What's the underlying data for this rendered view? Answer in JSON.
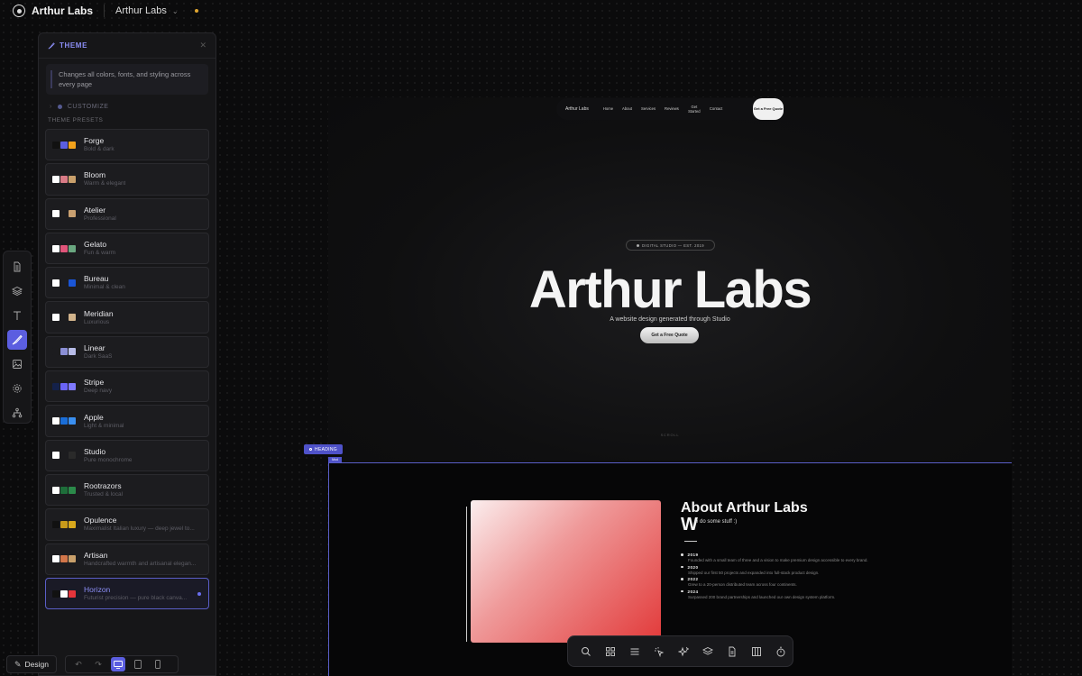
{
  "topbar": {
    "app_name": "Arthur Labs",
    "project_name": "Arthur Labs"
  },
  "panel": {
    "title": "THEME",
    "description": "Changes all colors, fonts, and styling across every page",
    "customize_label": "CUSTOMIZE",
    "presets_label": "THEME PRESETS",
    "presets": [
      {
        "name": "Forge",
        "desc": "Bold & dark",
        "colors": [
          "#111111",
          "#5b5ee0",
          "#f2a21b"
        ]
      },
      {
        "name": "Bloom",
        "desc": "Warm & elegant",
        "colors": [
          "#ffffff",
          "#d97b86",
          "#c9a06b"
        ]
      },
      {
        "name": "Atelier",
        "desc": "Professional",
        "colors": [
          "#ffffff",
          "#1c1c1f",
          "#c9a070"
        ]
      },
      {
        "name": "Gelato",
        "desc": "Fun & warm",
        "colors": [
          "#ffffff",
          "#e0557a",
          "#6aa780"
        ]
      },
      {
        "name": "Bureau",
        "desc": "Minimal & clean",
        "colors": [
          "#ffffff",
          "#1c1c1f",
          "#1a55d6"
        ]
      },
      {
        "name": "Meridian",
        "desc": "Luxurious",
        "colors": [
          "#ffffff",
          "#1c1c1f",
          "#d2b48c"
        ]
      },
      {
        "name": "Linear",
        "desc": "Dark SaaS",
        "colors": [
          "#1c1c1f",
          "#8b8fd6",
          "#b8bce8"
        ]
      },
      {
        "name": "Stripe",
        "desc": "Deep navy",
        "colors": [
          "#14214a",
          "#6a63f5",
          "#7f79ff"
        ]
      },
      {
        "name": "Apple",
        "desc": "Light & minimal",
        "colors": [
          "#ffffff",
          "#1a6ed8",
          "#3a8ff0"
        ]
      },
      {
        "name": "Studio",
        "desc": "Pure monochrome",
        "colors": [
          "#ffffff",
          "#1c1c1f",
          "#2a2a2a"
        ]
      },
      {
        "name": "Rootrazors",
        "desc": "Trusted & local",
        "colors": [
          "#ffffff",
          "#1e6e3a",
          "#2b8a4a"
        ]
      },
      {
        "name": "Opulence",
        "desc": "Maximalist Italian luxury — deep jewel to...",
        "colors": [
          "#111111",
          "#c89a1a",
          "#d8a81c"
        ]
      },
      {
        "name": "Artisan",
        "desc": "Handcrafted warmth and artisanal elegan...",
        "colors": [
          "#ffffff",
          "#d2764a",
          "#c9a06b"
        ]
      },
      {
        "name": "Horizon",
        "desc": "Futurist precision — pure black canva...",
        "colors": [
          "#111111",
          "#ffffff",
          "#e5353b"
        ],
        "active": true
      }
    ]
  },
  "rail": {
    "items": [
      "page-icon",
      "layers-icon",
      "text-icon",
      "brush-icon",
      "image-icon",
      "settings-icon",
      "sitemap-icon"
    ],
    "active": "brush-icon"
  },
  "bottom_left": {
    "design_label": "Design"
  },
  "site": {
    "nav": {
      "brand": "Arthur Labs",
      "links": [
        "Home",
        "About",
        "Services",
        "Reviews",
        "Get Started",
        "Contact"
      ],
      "cta": "Get a Free Quote"
    },
    "hero": {
      "badge": "DIGITAL STUDIO — EST. 2019",
      "title": "Arthur Labs",
      "subtitle": "A website design generated through Studio",
      "button": "Get a Free Quote",
      "scroll": "SCROLL"
    },
    "selection": {
      "chip": "HEADING",
      "mini": "Mod"
    },
    "about": {
      "title": "About Arthur Labs",
      "w_letter": "W",
      "tagline": "e do some stuff :)",
      "timeline": [
        {
          "year": "2019",
          "text": "Founded with a small team of three and a vision to make premium design accessible to every brand."
        },
        {
          "year": "2020",
          "text": "Shipped our first 50 projects and expanded into full-stack product design."
        },
        {
          "year": "2022",
          "text": "Grew to a 20-person distributed team across four continents."
        },
        {
          "year": "2024",
          "text": "Surpassed 200 brand partnerships and launched our own design system platform."
        }
      ]
    }
  },
  "toolbar": {
    "icons": [
      "search-icon",
      "grid-icon",
      "list-icon",
      "sparkle-cursor-icon",
      "ai-sparkle-icon",
      "layers-icon",
      "document-icon",
      "columns-icon",
      "timer-icon"
    ]
  },
  "colors": {
    "accent": "#5b5ee0",
    "background": "#0b0b0c",
    "status_dot": "#e0a630"
  }
}
